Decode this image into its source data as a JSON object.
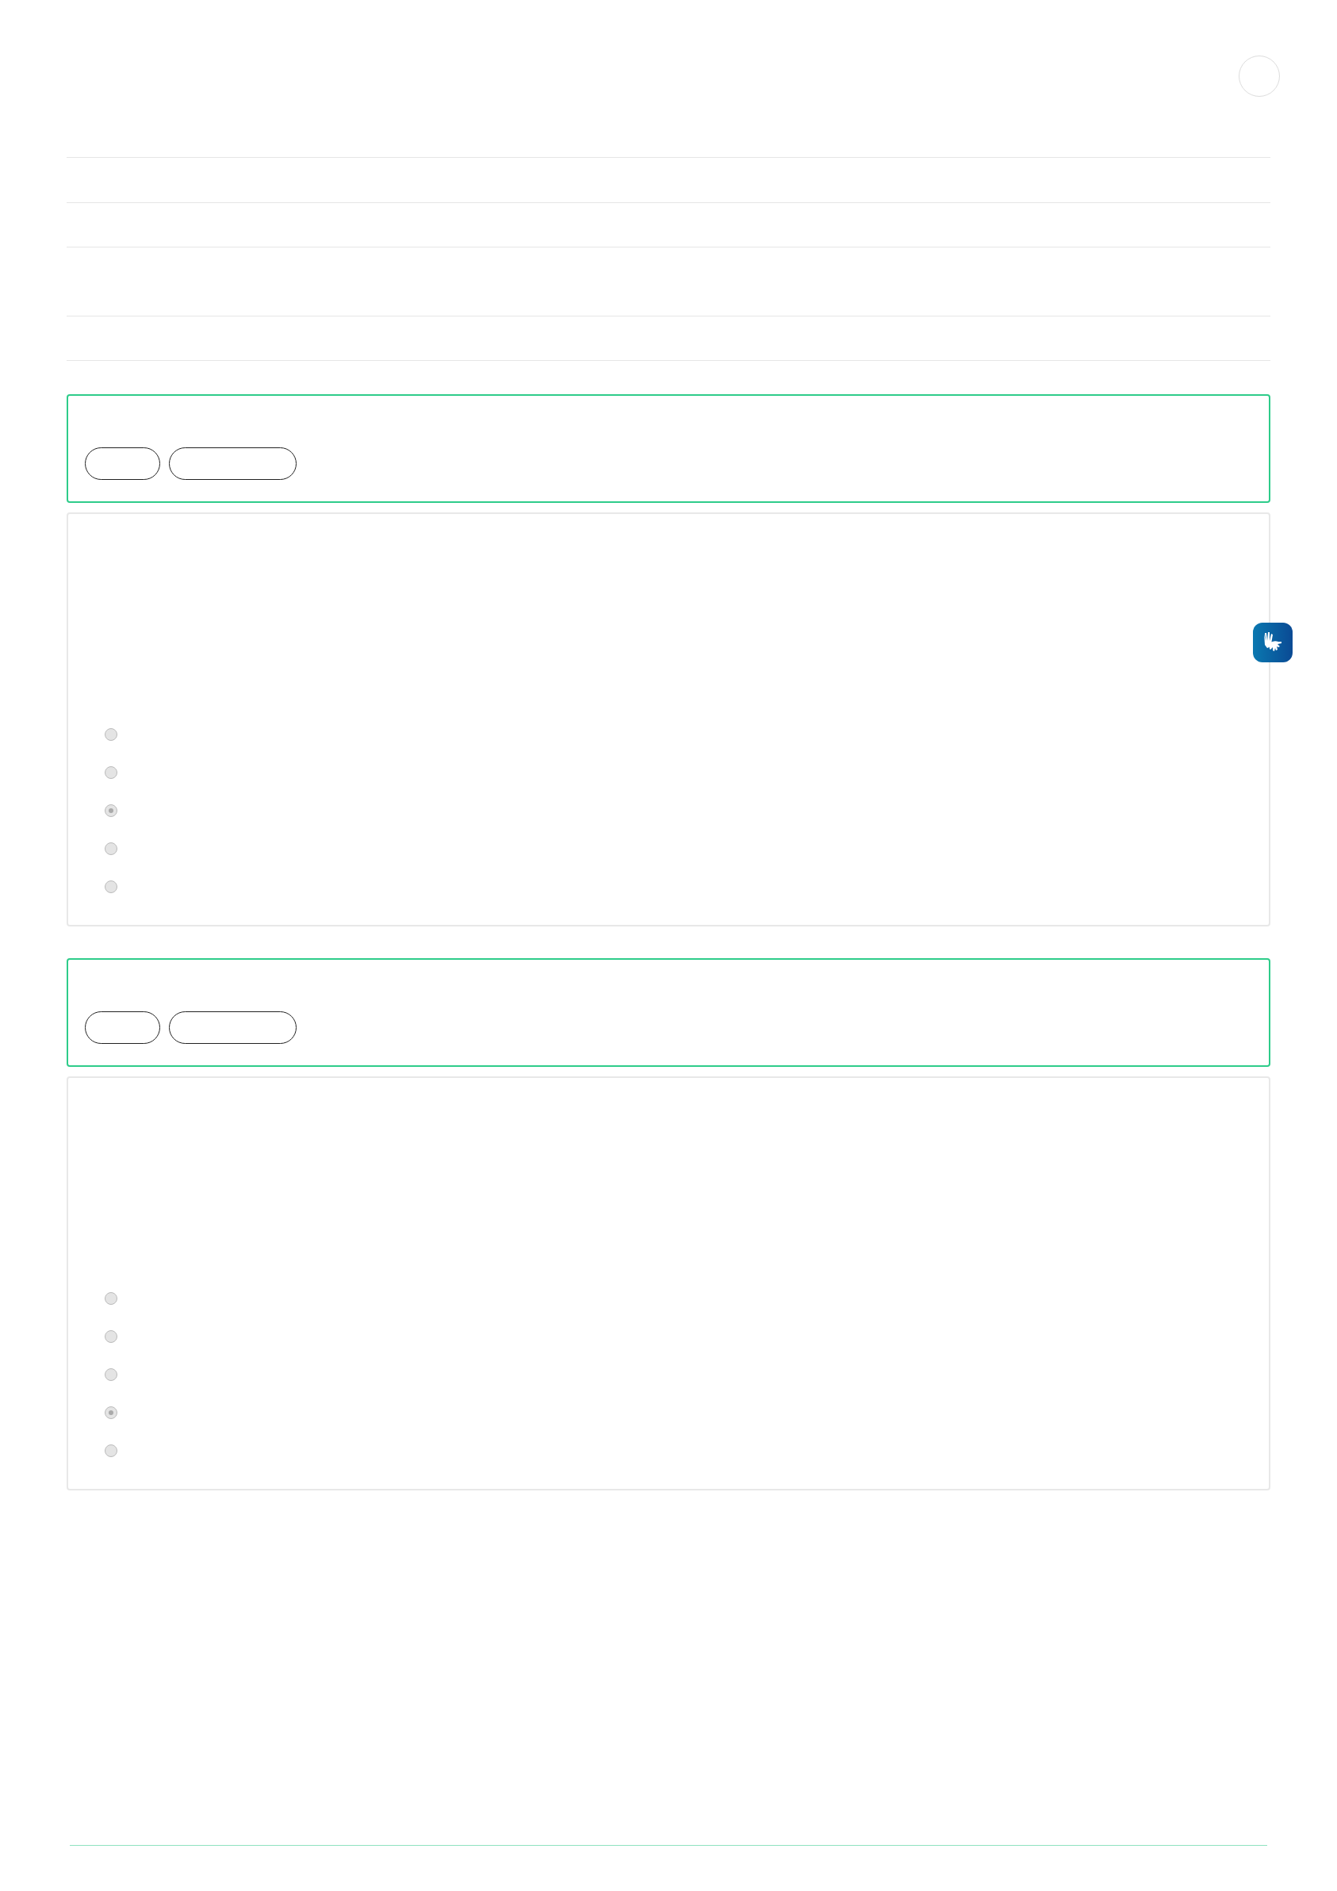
{
  "questions": [
    {
      "options": [
        {
          "selected": false
        },
        {
          "selected": false
        },
        {
          "selected": true
        },
        {
          "selected": false
        },
        {
          "selected": false
        }
      ]
    },
    {
      "options": [
        {
          "selected": false
        },
        {
          "selected": false
        },
        {
          "selected": false
        },
        {
          "selected": true
        },
        {
          "selected": false
        }
      ]
    }
  ]
}
